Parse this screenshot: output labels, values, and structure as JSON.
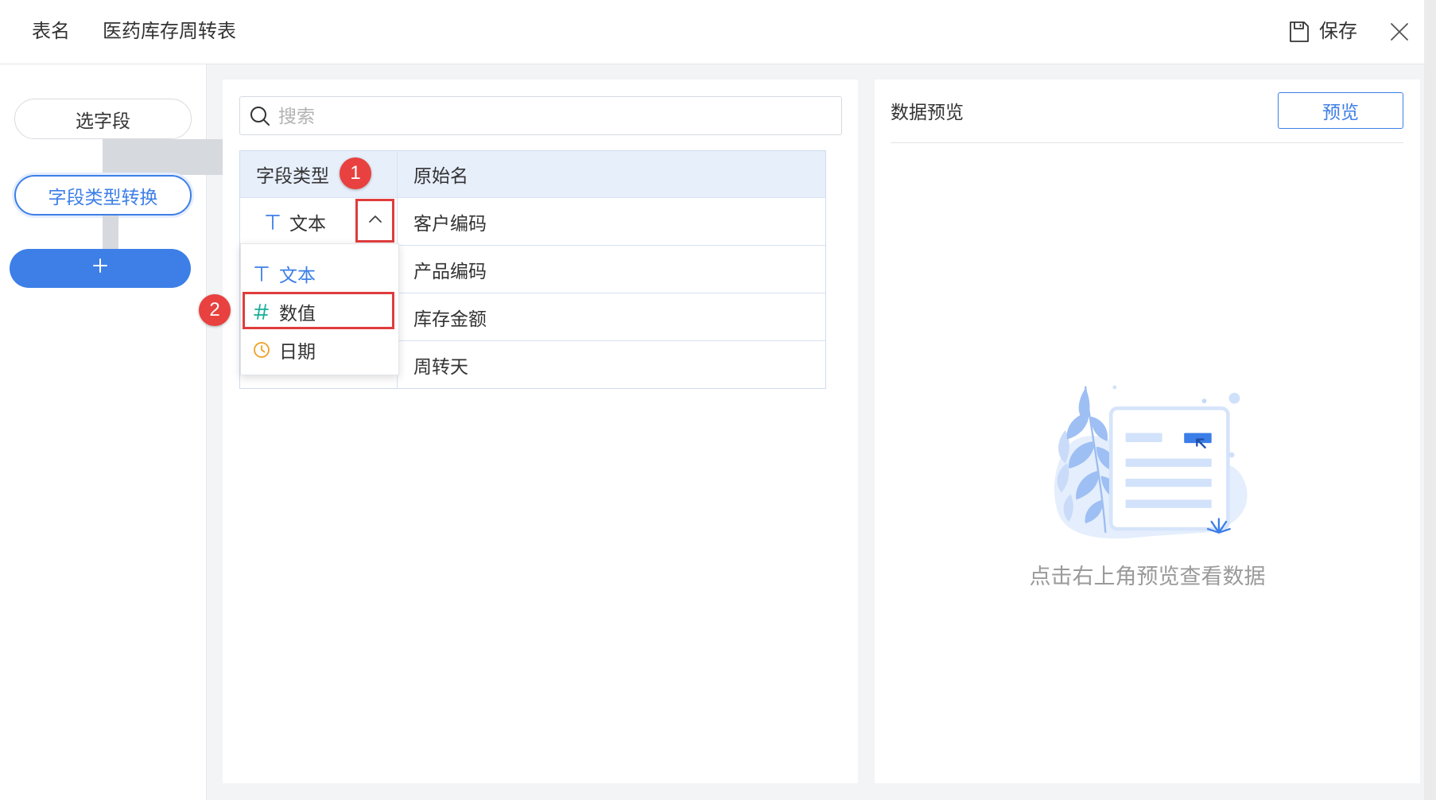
{
  "header": {
    "table_name_label": "表名",
    "table_name": "医药库存周转表",
    "save_label": "保存",
    "save_icon": "save-icon",
    "close_icon": "close-icon"
  },
  "sidebar": {
    "steps": [
      {
        "label": "选字段",
        "active": false
      },
      {
        "label": "字段类型转换",
        "active": true
      }
    ],
    "add_icon": "plus-icon"
  },
  "search": {
    "placeholder": "搜索",
    "icon": "search-icon"
  },
  "field_table": {
    "columns": [
      "字段类型",
      "原始名"
    ],
    "rows": [
      {
        "field_type": "文本",
        "field_type_icon": "text-type-icon",
        "original_name": "客户编码"
      },
      {
        "original_name": "产品编码"
      },
      {
        "original_name": "库存金额"
      },
      {
        "original_name": "周转天"
      }
    ]
  },
  "type_dropdown": {
    "expanded": true,
    "toggle_icon": "chevron-up-icon",
    "options": [
      {
        "label": "文本",
        "icon": "text-type-icon",
        "selected": true
      },
      {
        "label": "数值",
        "icon": "number-type-icon",
        "selected": false
      },
      {
        "label": "日期",
        "icon": "date-type-icon",
        "selected": false
      }
    ]
  },
  "annotations": [
    {
      "label": "1"
    },
    {
      "label": "2"
    }
  ],
  "preview": {
    "title": "数据预览",
    "button_label": "预览",
    "empty_message": "点击右上角预览查看数据"
  },
  "colors": {
    "accent": "#3d7fe7",
    "annotation": "#e03c3c",
    "number_icon": "#18ae98",
    "date_icon": "#f0a023"
  }
}
